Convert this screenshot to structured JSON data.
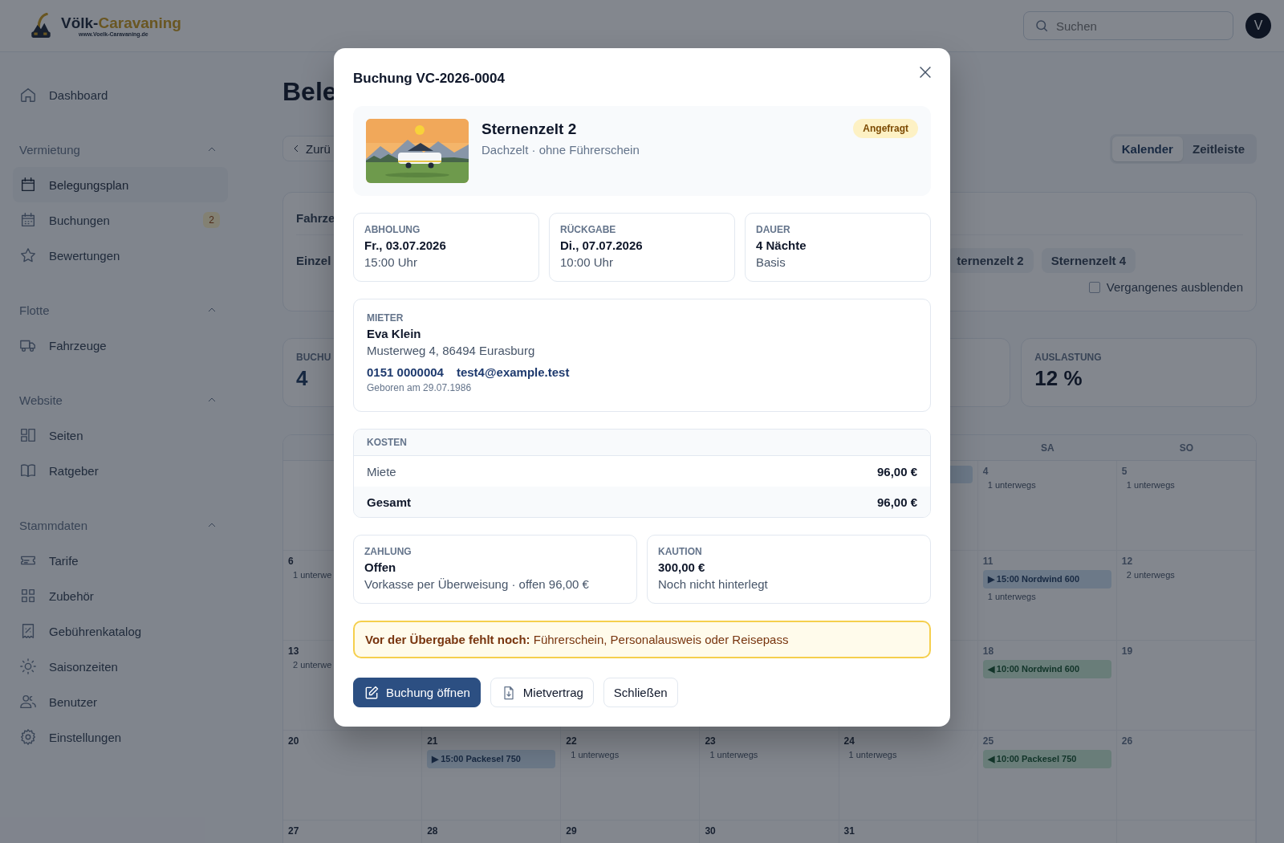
{
  "header": {
    "logo": {
      "name_main": "Völk-",
      "name_accent": "Caravaning",
      "url": "www.Voelk-Caravaning.de"
    },
    "search": {
      "placeholder": "Suchen"
    },
    "avatar": "V"
  },
  "sidebar": {
    "top": [
      {
        "label": "Dashboard",
        "selected": false
      }
    ],
    "sections": [
      {
        "title": "Vermietung",
        "expanded": true,
        "items": [
          {
            "label": "Belegungsplan",
            "selected": true
          },
          {
            "label": "Buchungen",
            "selected": false,
            "badge": "2"
          },
          {
            "label": "Bewertungen",
            "selected": false
          }
        ]
      },
      {
        "title": "Flotte",
        "expanded": true,
        "items": [
          {
            "label": "Fahrzeuge",
            "selected": false
          }
        ]
      },
      {
        "title": "Website",
        "expanded": true,
        "items": [
          {
            "label": "Seiten",
            "selected": false
          },
          {
            "label": "Ratgeber",
            "selected": false
          }
        ]
      },
      {
        "title": "Stammdaten",
        "expanded": true,
        "items": [
          {
            "label": "Tarife",
            "selected": false
          },
          {
            "label": "Zubehör",
            "selected": false
          },
          {
            "label": "Gebührenkatalog",
            "selected": false
          },
          {
            "label": "Saisonzeiten",
            "selected": false
          },
          {
            "label": "Benutzer",
            "selected": false
          },
          {
            "label": "Einstellungen",
            "selected": false
          }
        ]
      }
    ]
  },
  "page": {
    "title": "Bele",
    "back_button": "Zurü",
    "view_tabs": [
      {
        "label": "Kalender",
        "selected": true
      },
      {
        "label": "Zeitleiste",
        "selected": false
      }
    ],
    "filters": {
      "rows": [
        {
          "label": "Fahrze"
        },
        {
          "label": "Einzel",
          "chips": [
            "ternenzelt 2",
            "Sternenzelt 4"
          ]
        }
      ],
      "hide_past": {
        "label": "Vergangenes ausblenden",
        "checked": false
      }
    },
    "stats": {
      "bookings": {
        "label": "BUCHU",
        "value": "4"
      },
      "utilization": {
        "label": "AUSLASTUNG",
        "value": "12 %"
      }
    },
    "calendar": {
      "weekdays": {
        "sa": "SA",
        "so": "SO"
      },
      "weeks": [
        {
          "fr": {
            "events": [
              {
                "kind": "arrival"
              }
            ]
          },
          "sa": {
            "day": "4",
            "notes": [
              "1 unterwegs"
            ]
          },
          "so": {
            "day": "5",
            "notes": [
              "1 unterwegs"
            ]
          }
        },
        {
          "mo": {
            "day": "6",
            "notes": [
              "1 unterwe"
            ]
          },
          "sa": {
            "day": "11",
            "events": [
              {
                "kind": "arrival",
                "label": "▶ 15:00 Nordwind 600"
              }
            ],
            "notes": [
              "1 unterwegs"
            ]
          },
          "so": {
            "day": "12",
            "notes": [
              "2 unterwegs"
            ]
          }
        },
        {
          "mo": {
            "day": "13",
            "notes": [
              "2 unterwe"
            ]
          },
          "sa": {
            "day": "18",
            "events": [
              {
                "kind": "return",
                "label": "◀ 10:00 Nordwind 600"
              }
            ]
          },
          "so": {
            "day": "19"
          }
        },
        {
          "mo": {
            "day": "20"
          },
          "di": {
            "day": "21",
            "events": [
              {
                "kind": "arrival",
                "label": "▶ 15:00 Packesel 750"
              }
            ]
          },
          "mi": {
            "day": "22",
            "notes": [
              "1 unterwegs"
            ]
          },
          "do": {
            "day": "23",
            "notes": [
              "1 unterwegs"
            ]
          },
          "fr": {
            "day": "24",
            "notes": [
              "1 unterwegs"
            ]
          },
          "sa": {
            "day": "25",
            "events": [
              {
                "kind": "return",
                "label": "◀ 10:00 Packesel 750"
              }
            ]
          },
          "so": {
            "day": "26"
          }
        },
        {
          "mo": {
            "day": "27"
          },
          "di": {
            "day": "28"
          },
          "mi": {
            "day": "29"
          },
          "do": {
            "day": "30"
          },
          "fr": {
            "day": "31"
          }
        }
      ]
    }
  },
  "modal": {
    "title": "Buchung VC-2026-0004",
    "vehicle": {
      "kind": "picture",
      "name": "Sternenzelt 2",
      "subtitle": "Dachzelt · ohne Führerschein",
      "status": "Angefragt"
    },
    "schedule": [
      {
        "label": "ABHOLUNG",
        "value": "Fr., 03.07.2026",
        "detail": "15:00 Uhr"
      },
      {
        "label": "RÜCKGABE",
        "value": "Di., 07.07.2026",
        "detail": "10:00 Uhr"
      },
      {
        "label": "DAUER",
        "value": "4 Nächte",
        "detail": "Basis"
      }
    ],
    "renter": {
      "label": "MIETER",
      "name": "Eva Klein",
      "address": "Musterweg 4, 86494 Eurasburg",
      "phone": "0151 0000004",
      "email": "test4@example.test",
      "birth": "Geboren am 29.07.1986"
    },
    "costs": {
      "label": "KOSTEN",
      "rows": [
        {
          "kind": "item",
          "label": "Miete",
          "amount": "96,00 €"
        },
        {
          "kind": "total",
          "label": "Gesamt",
          "amount": "96,00 €"
        }
      ]
    },
    "payment": [
      {
        "label": "ZAHLUNG",
        "value": "Offen",
        "detail": "Vorkasse per Überweisung · offen 96,00 €"
      },
      {
        "label": "KAUTION",
        "value": "300,00 €",
        "detail": "Noch nicht hinterlegt"
      }
    ],
    "warning": "**Vor der Übergabe fehlt noch:** Führerschein, Personalausweis oder Reisepass",
    "actions": [
      {
        "kind": "primary",
        "label": "Buchung öffnen"
      },
      {
        "kind": "document",
        "label": "Mietvertrag"
      },
      {
        "kind": "plain",
        "label": "Schließen"
      }
    ]
  }
}
